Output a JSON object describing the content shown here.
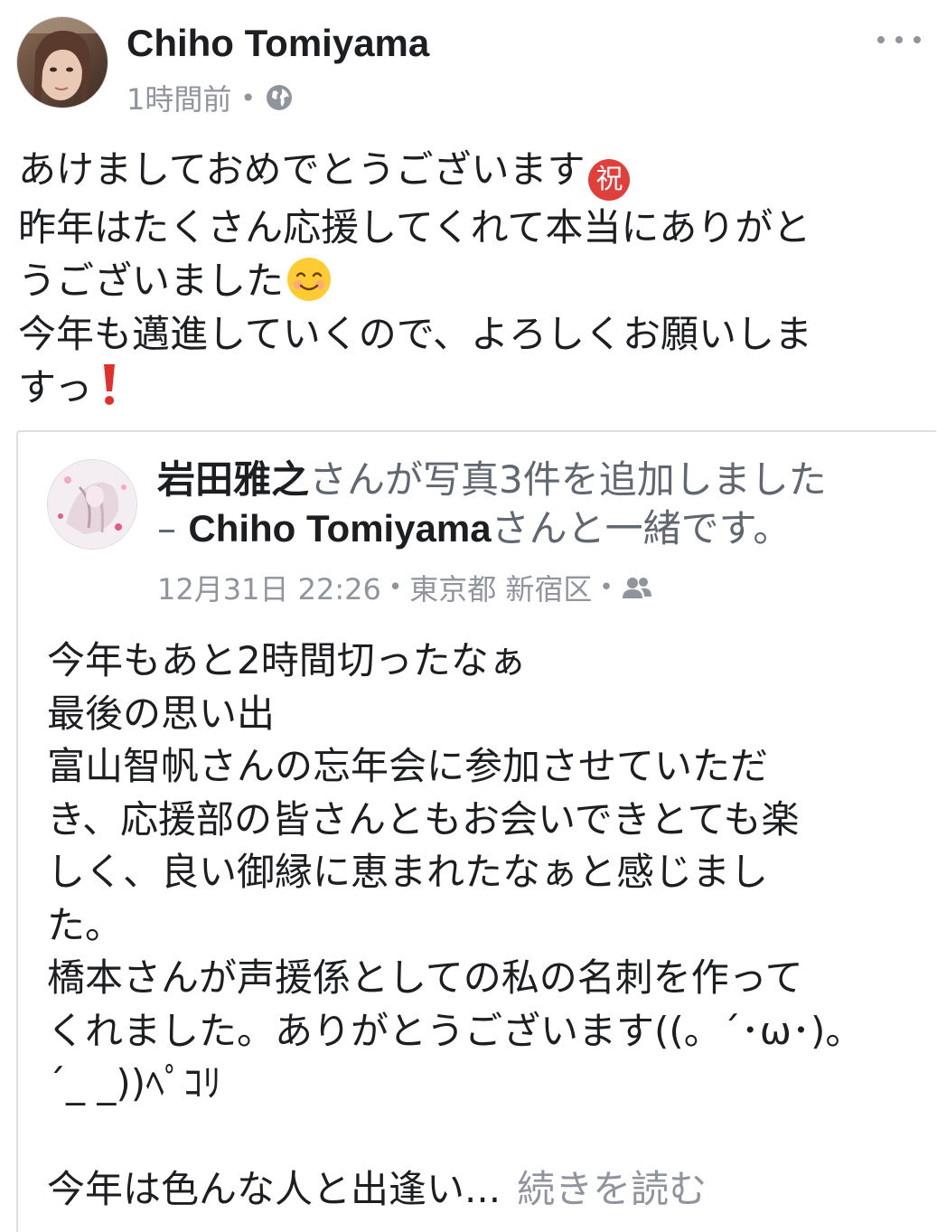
{
  "post": {
    "author": "Chiho Tomiyama",
    "timestamp": "1時間前",
    "separator": "•",
    "privacy_icon": "globe-icon",
    "more_icon": "more-options-icon",
    "text_lines": [
      "あけましておめでとうございます",
      "昨年はたくさん応援してくれて本当にありがと",
      "うございました",
      "今年も邁進していくので、よろしくお願いしま",
      "すっ"
    ],
    "emoji_iwai": "祝"
  },
  "shared": {
    "actor": "岩田雅之",
    "action": "さんが写真3件を追加しました",
    "with_prefix": "– ",
    "with_name": "Chiho Tomiyama",
    "with_suffix": "さんと一緒です。",
    "timestamp": "12月31日 22:26",
    "separator": "•",
    "location": "東京都 新宿区",
    "audience_icon": "friends-icon",
    "text_lines": [
      "今年もあと2時間切ったなぁ",
      "最後の思い出",
      "富山智帆さんの忘年会に参加させていただ",
      "き、応援部の皆さんともお会いできとても楽",
      "しく、良い御縁に恵まれたなぁと感じまし",
      "た。",
      "橋本さんが声援係としての私の名刺を作って",
      "くれました。ありがとうございます((。´･ω･)。",
      "´_ _))ﾍﾟｺﾘ",
      "",
      "今年は色んな人と出逢い..."
    ],
    "see_more": "続きを読む"
  },
  "colors": {
    "text_primary": "#1c1e21",
    "text_secondary": "#90949c",
    "border": "#dddfe2",
    "iwai_badge": "#e0403b"
  }
}
